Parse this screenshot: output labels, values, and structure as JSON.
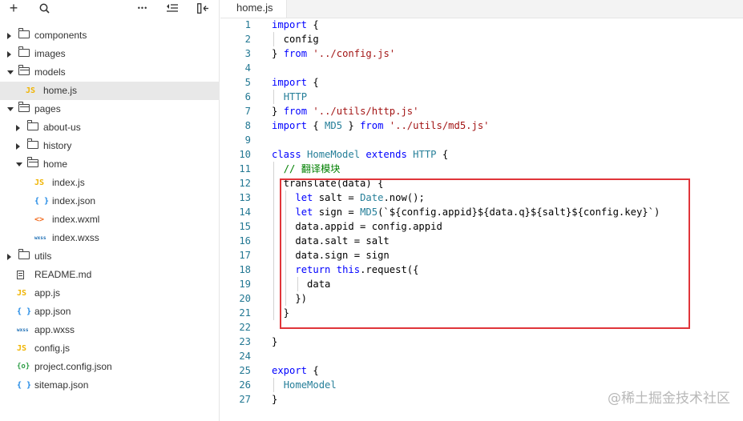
{
  "sidebar": {
    "toolbar": {
      "add_icon": "+",
      "search_icon": "search-icon",
      "more_icon": "•••",
      "collapse_icon": "collapse-all-icon",
      "split_icon": "split-view-icon"
    },
    "tree": [
      {
        "label": "components",
        "kind": "folder",
        "expanded": false,
        "depth": 0
      },
      {
        "label": "images",
        "kind": "folder",
        "expanded": false,
        "depth": 0
      },
      {
        "label": "models",
        "kind": "folder",
        "expanded": true,
        "depth": 0
      },
      {
        "label": "home.js",
        "kind": "js",
        "depth": 1,
        "selected": true
      },
      {
        "label": "pages",
        "kind": "folder",
        "expanded": true,
        "depth": 0
      },
      {
        "label": "about-us",
        "kind": "folder",
        "expanded": false,
        "depth": 1
      },
      {
        "label": "history",
        "kind": "folder",
        "expanded": false,
        "depth": 1
      },
      {
        "label": "home",
        "kind": "folder",
        "expanded": true,
        "depth": 1
      },
      {
        "label": "index.js",
        "kind": "js",
        "depth": 2
      },
      {
        "label": "index.json",
        "kind": "json",
        "depth": 2
      },
      {
        "label": "index.wxml",
        "kind": "wxml",
        "depth": 2
      },
      {
        "label": "index.wxss",
        "kind": "wxss",
        "depth": 2
      },
      {
        "label": "utils",
        "kind": "folder",
        "expanded": false,
        "depth": 0
      },
      {
        "label": "README.md",
        "kind": "md",
        "depth": 0
      },
      {
        "label": "app.js",
        "kind": "js",
        "depth": 0
      },
      {
        "label": "app.json",
        "kind": "json",
        "depth": 0
      },
      {
        "label": "app.wxss",
        "kind": "wxss",
        "depth": 0
      },
      {
        "label": "config.js",
        "kind": "js",
        "depth": 0
      },
      {
        "label": "project.config.json",
        "kind": "cfgjson",
        "depth": 0
      },
      {
        "label": "sitemap.json",
        "kind": "json",
        "depth": 0
      }
    ],
    "icon_glyphs": {
      "js": "JS",
      "json": "{ }",
      "wxml": "<>",
      "wxss": "wxss",
      "cfgjson": "{o}"
    }
  },
  "editor": {
    "active_tab": "home.js",
    "lines": [
      [
        [
          "kw",
          "import"
        ],
        [
          "pl",
          " {"
        ]
      ],
      [
        [
          "pl",
          "  config"
        ]
      ],
      [
        [
          "pl",
          "} "
        ],
        [
          "kw",
          "from"
        ],
        [
          "pl",
          " "
        ],
        [
          "str",
          "'../config.js'"
        ]
      ],
      [],
      [
        [
          "kw",
          "import"
        ],
        [
          "pl",
          " {"
        ]
      ],
      [
        [
          "pl",
          "  "
        ],
        [
          "cls",
          "HTTP"
        ]
      ],
      [
        [
          "pl",
          "} "
        ],
        [
          "kw",
          "from"
        ],
        [
          "pl",
          " "
        ],
        [
          "str",
          "'../utils/http.js'"
        ]
      ],
      [
        [
          "kw",
          "import"
        ],
        [
          "pl",
          " { "
        ],
        [
          "cls",
          "MD5"
        ],
        [
          "pl",
          " } "
        ],
        [
          "kw",
          "from"
        ],
        [
          "pl",
          " "
        ],
        [
          "str",
          "'../utils/md5.js'"
        ]
      ],
      [],
      [
        [
          "kw",
          "class"
        ],
        [
          "pl",
          " "
        ],
        [
          "cls",
          "HomeModel"
        ],
        [
          "pl",
          " "
        ],
        [
          "kw",
          "extends"
        ],
        [
          "pl",
          " "
        ],
        [
          "cls",
          "HTTP"
        ],
        [
          "pl",
          " {"
        ]
      ],
      [
        [
          "pl",
          "  "
        ],
        [
          "cmt",
          "// 翻译模块"
        ]
      ],
      [
        [
          "pl",
          "  translate(data) {"
        ]
      ],
      [
        [
          "pl",
          "    "
        ],
        [
          "kw",
          "let"
        ],
        [
          "pl",
          " salt = "
        ],
        [
          "cls",
          "Date"
        ],
        [
          "pl",
          ".now();"
        ]
      ],
      [
        [
          "pl",
          "    "
        ],
        [
          "kw",
          "let"
        ],
        [
          "pl",
          " sign = "
        ],
        [
          "cls",
          "MD5"
        ],
        [
          "pl",
          "(`${config.appid}${data.q}${salt}${config.key}`)"
        ]
      ],
      [
        [
          "pl",
          "    data.appid = config.appid"
        ]
      ],
      [
        [
          "pl",
          "    data.salt = salt"
        ]
      ],
      [
        [
          "pl",
          "    data.sign = sign"
        ]
      ],
      [
        [
          "pl",
          "    "
        ],
        [
          "kw",
          "return"
        ],
        [
          "pl",
          " "
        ],
        [
          "kw",
          "this"
        ],
        [
          "pl",
          ".request({"
        ]
      ],
      [
        [
          "pl",
          "      data"
        ]
      ],
      [
        [
          "pl",
          "    })"
        ]
      ],
      [
        [
          "pl",
          "  }"
        ]
      ],
      [],
      [
        [
          "pl",
          "}"
        ]
      ],
      [],
      [
        [
          "kw",
          "export"
        ],
        [
          "pl",
          " {"
        ]
      ],
      [
        [
          "pl",
          "  "
        ],
        [
          "cls",
          "HomeModel"
        ]
      ],
      [
        [
          "pl",
          "}"
        ]
      ]
    ]
  },
  "watermark": "@稀土掘金技术社区"
}
